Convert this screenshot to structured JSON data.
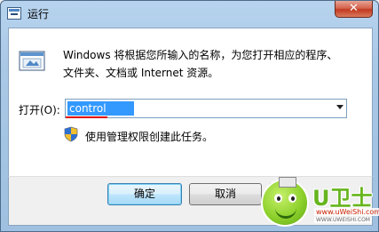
{
  "window": {
    "title": "运行",
    "close_glyph": "✕"
  },
  "description": "Windows 将根据您所输入的名称，为您打开相应的程序、文件夹、文档或 Internet 资源。",
  "open_field": {
    "label": "打开(O):",
    "value": "control"
  },
  "admin_note": "使用管理权限创建此任务。",
  "buttons": {
    "ok": "确定",
    "cancel": "取消"
  },
  "watermark": {
    "brand": "U卫士",
    "url": "www.uWeiShi.com",
    "url_small": "WWW.UWEISHI.COM"
  },
  "icons": {
    "app": "run-dialog-icon",
    "run": "run-program-icon",
    "shield": "uac-shield-icon",
    "dropdown": "chevron-down-icon"
  },
  "colors": {
    "selection": "#3399ff",
    "underline": "#e00000",
    "close": "#c23a1f"
  }
}
